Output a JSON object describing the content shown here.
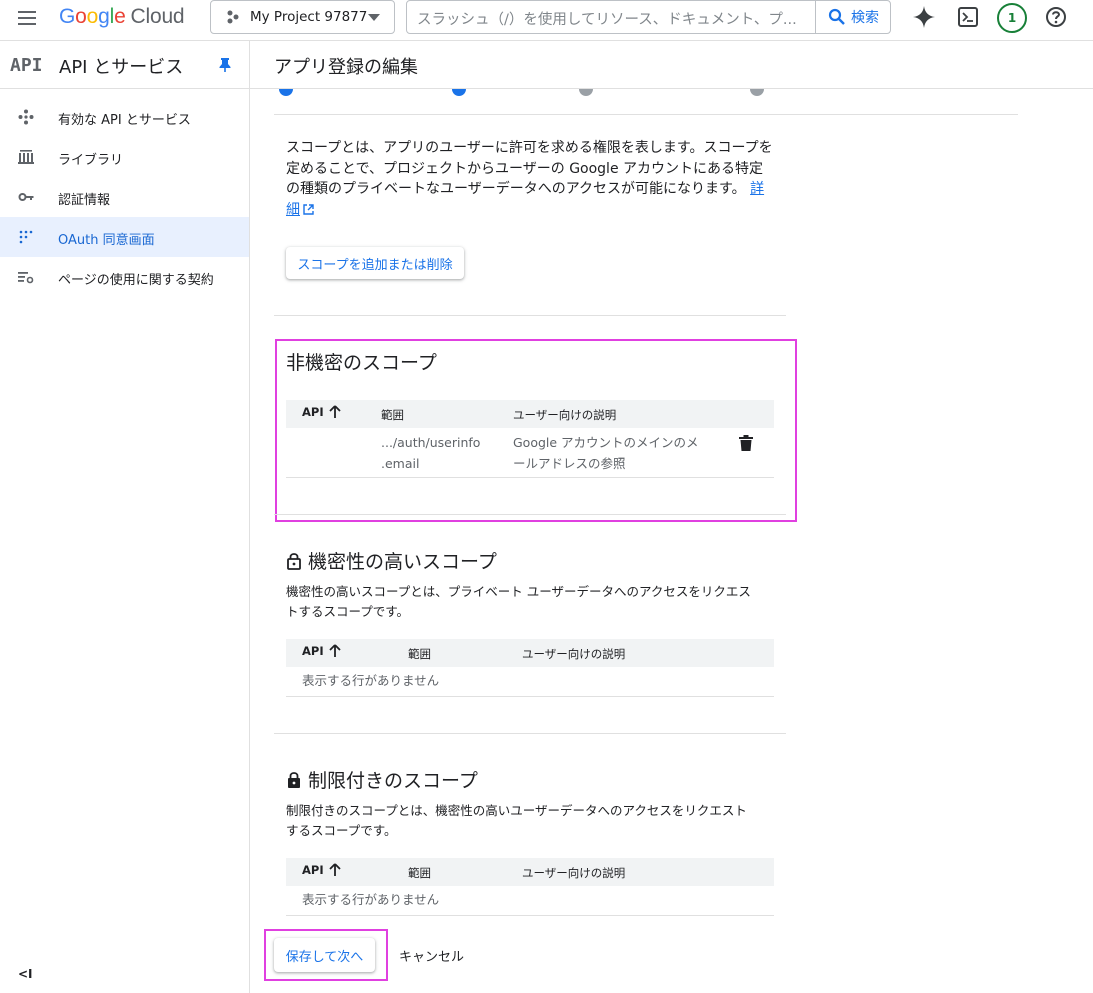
{
  "topbar": {
    "logo": {
      "g1": "G",
      "o1": "o",
      "o2": "o",
      "g2": "g",
      "l": "l",
      "e": "e",
      "cloud": "Cloud"
    },
    "project": "My Project 97877",
    "search_placeholder": "スラッシュ（/）を使用してリソース、ドキュメント、プ...",
    "search_button": "検索",
    "notification_count": "1"
  },
  "sidebar": {
    "logo": "API",
    "title": "API とサービス",
    "items": [
      {
        "label": "有効な API とサービス",
        "icon": "enabled-apis-icon",
        "active": false
      },
      {
        "label": "ライブラリ",
        "icon": "library-icon",
        "active": false
      },
      {
        "label": "認証情報",
        "icon": "key-icon",
        "active": false
      },
      {
        "label": "OAuth 同意画面",
        "icon": "oauth-consent-icon",
        "active": true
      },
      {
        "label": "ページの使用に関する契約",
        "icon": "page-usage-icon",
        "active": false
      }
    ],
    "collapse_label": "<I"
  },
  "page": {
    "title": "アプリ登録の編集",
    "intro": "スコープとは、アプリのユーザーに許可を求める権限を表します。スコープを定めることで、プロジェクトからユーザーの Google アカウントにある特定の種類のプライベートなユーザーデータへのアクセスが可能になります。",
    "details_link": "詳細",
    "add_scope_button": "スコープを追加または削除",
    "sections": {
      "non_sensitive": {
        "title": "非機密のスコープ",
        "headers": {
          "api": "API",
          "scope": "範囲",
          "desc": "ユーザー向けの説明"
        },
        "rows": [
          {
            "api": "",
            "scope_line1": ".../auth/userinfo",
            "scope_line2": ".email",
            "desc_line1": "Google アカウントのメインのメ",
            "desc_line2": "ールアドレスの参照"
          }
        ]
      },
      "sensitive": {
        "title": "機密性の高いスコープ",
        "desc_line1": "機密性の高いスコープとは、プライベート ユーザーデータへのアクセスをリクエス",
        "desc_line2": "トするスコープです。",
        "headers": {
          "api": "API",
          "scope": "範囲",
          "desc": "ユーザー向けの説明"
        },
        "empty": "表示する行がありません"
      },
      "restricted": {
        "title": "制限付きのスコープ",
        "desc_line1": "制限付きのスコープとは、機密性の高いユーザーデータへのアクセスをリクエスト",
        "desc_line2": "するスコープです。",
        "headers": {
          "api": "API",
          "scope": "範囲",
          "desc": "ユーザー向けの説明"
        },
        "empty": "表示する行がありません"
      }
    },
    "save_button": "保存して次へ",
    "cancel_button": "キャンセル"
  },
  "colors": {
    "accent": "#1a73e8",
    "highlight": "#e040e0",
    "active_nav_bg": "#e8f0fe",
    "badge_green": "#188038"
  }
}
